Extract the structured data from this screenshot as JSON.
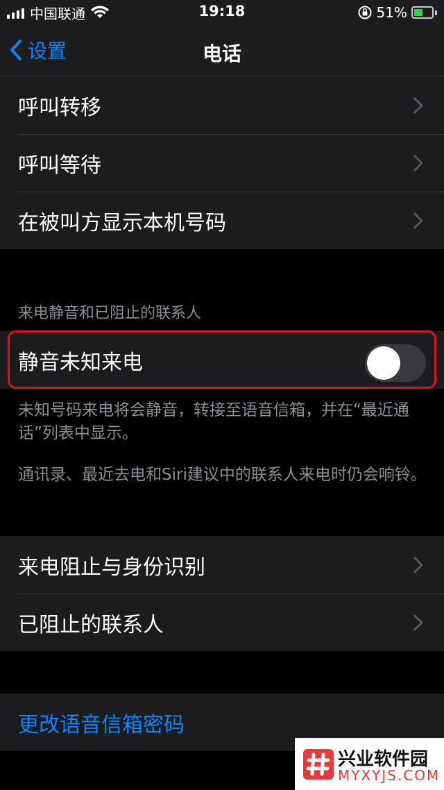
{
  "status_bar": {
    "carrier": "中国联通",
    "time": "19:18",
    "battery_percent": "51%",
    "battery_level": 0.51
  },
  "nav": {
    "back_label": "设置",
    "title": "电话"
  },
  "group1": {
    "items": [
      {
        "label": "呼叫转移"
      },
      {
        "label": "呼叫等待"
      },
      {
        "label": "在被叫方显示本机号码"
      }
    ]
  },
  "silence_section": {
    "header": "来电静音和已阻止的联系人",
    "toggle_label": "静音未知来电",
    "toggle_on": false,
    "footer_1": "未知号码来电将会静音，转接至语音信箱，并在“最近通话”列表中显示。",
    "footer_2": "通讯录、最近去电和Siri建议中的联系人来电时仍会响铃。"
  },
  "group2": {
    "items": [
      {
        "label": "来电阻止与身份识别"
      },
      {
        "label": "已阻止的联系人"
      }
    ]
  },
  "voicemail": {
    "change_password_label": "更改语音信箱密码"
  },
  "watermark": {
    "title": "兴业软件园",
    "subtitle": "MYXYJS.COM"
  },
  "colors": {
    "accent": "#0a84ff",
    "cell_background": "#1c1c1e",
    "secondary_text": "#8d8d93",
    "highlight_border": "#d9161a"
  }
}
